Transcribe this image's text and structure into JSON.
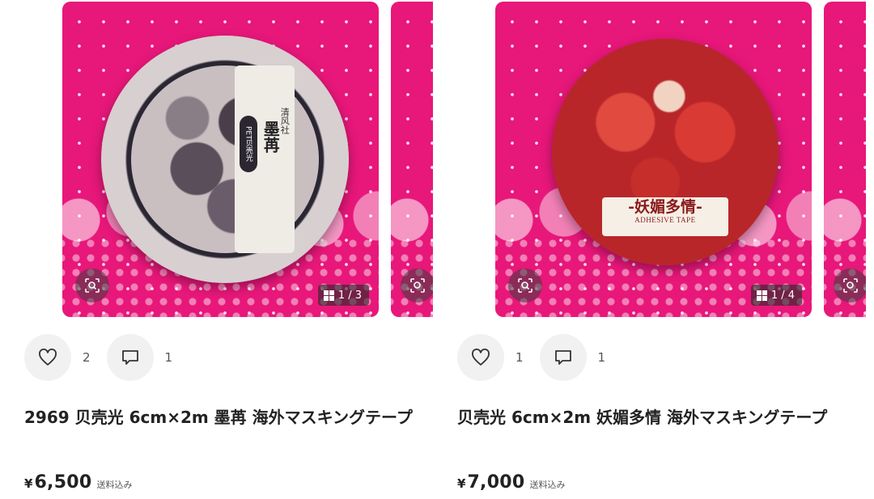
{
  "products": [
    {
      "tape_label_vertical": "PET贝壳光",
      "tape_brand": "清风社",
      "tape_name": "墨苒",
      "image_counter": "1 / 3",
      "likes": "2",
      "comments": "1",
      "title": "2969 贝壳光 6cm×2m 墨苒 海外マスキングテープ",
      "currency": "¥",
      "price": "6,500",
      "shipping": "送料込み"
    },
    {
      "tape_band_title": "-妖媚多情-",
      "tape_band_sub": "ADHESIVE TAPE",
      "image_counter": "1 / 4",
      "likes": "1",
      "comments": "1",
      "title": "贝壳光 6cm×2m 妖媚多情 海外マスキングテープ",
      "currency": "¥",
      "price": "7,000",
      "shipping": "送料込み"
    }
  ],
  "colors": {
    "background_pink": "#e8177a",
    "button_gray": "#f1f1f1"
  },
  "icons": {
    "like": "heart-icon",
    "comment": "comment-icon",
    "lens": "image-search-icon",
    "gallery": "grid-icon"
  }
}
